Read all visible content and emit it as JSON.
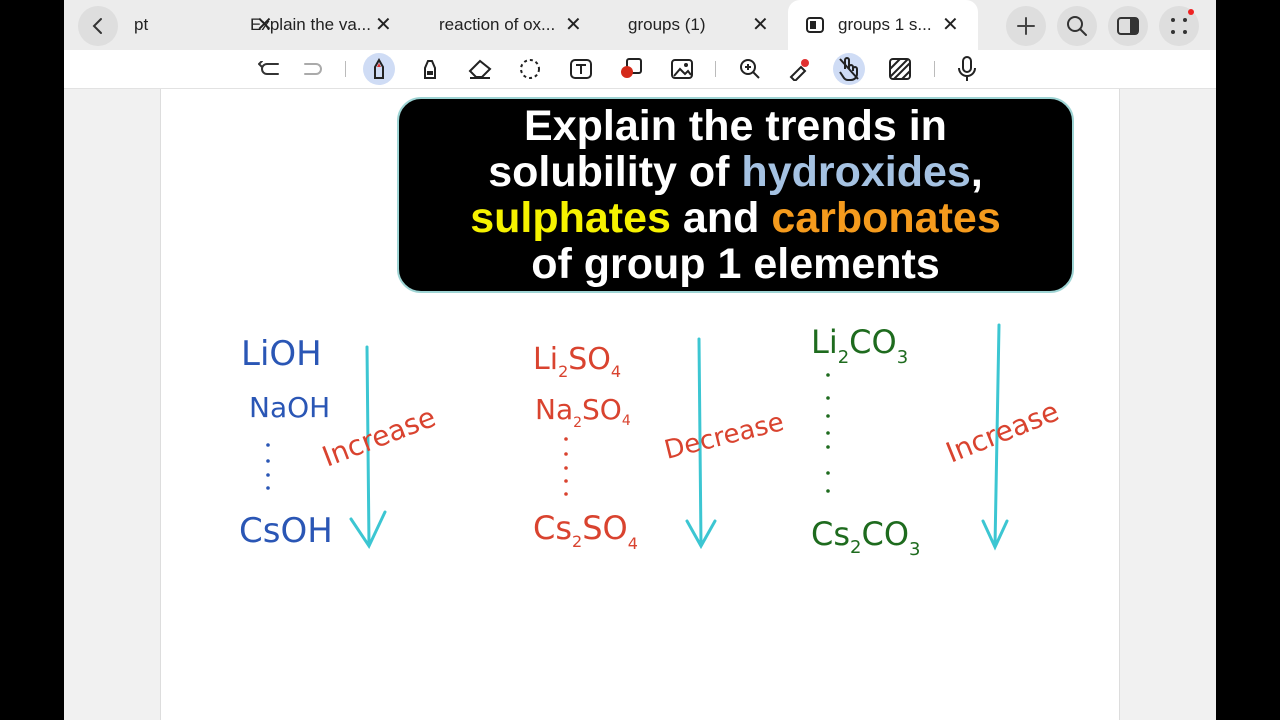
{
  "tabs": [
    {
      "label": "pt",
      "active": false
    },
    {
      "label": "Explain the va...",
      "active": false
    },
    {
      "label": "reaction of ox...",
      "active": false
    },
    {
      "label": "groups (1)",
      "active": false
    },
    {
      "label": "groups 1 s...",
      "active": true
    }
  ],
  "tab_close_glyph": "✕",
  "title_card": {
    "line1": "Explain the trends in",
    "line2_prefix": "solubility of ",
    "line2_highlight": "hydroxides",
    "line2_suffix": ",",
    "line3_highlight1": "sulphates",
    "line3_middle": " and ",
    "line3_highlight2": "carbonates",
    "line4": "of group 1 elements",
    "colors": {
      "hydroxides": "#a5c2e2",
      "sulphates": "#f6f200",
      "carbonates": "#f59b1d"
    }
  },
  "notes": {
    "hydroxides": {
      "top": "LiOH",
      "second": "NaOH",
      "bottom": "CsOH",
      "trend": "Increase",
      "ink_color": "#2a56b5"
    },
    "sulphates": {
      "top": "Li2SO4",
      "second": "Na2SO4",
      "bottom": "Cs2SO4",
      "trend": "Decrease",
      "ink_color": "#d9432f"
    },
    "carbonates": {
      "top": "Li2CO3",
      "bottom": "Cs2CO3",
      "trend": "Increase",
      "ink_color": "#1e6b1e"
    },
    "arrow_color": "#3cc6d2",
    "trend_color": "#d9432f"
  }
}
